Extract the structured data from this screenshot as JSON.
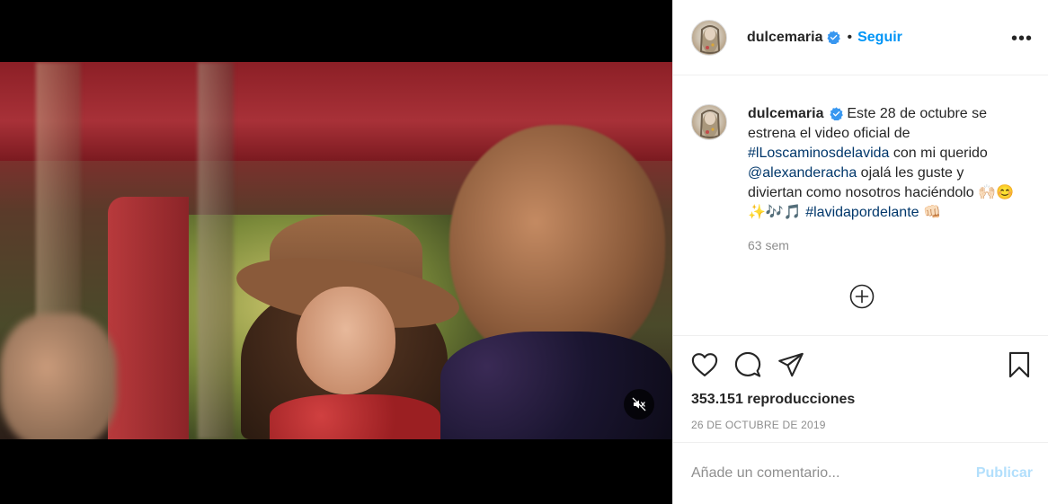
{
  "post": {
    "username": "dulcemaria",
    "follow_label": "Seguir",
    "dot": "•",
    "more_label": "•••",
    "caption": {
      "username": "dulcemaria",
      "text_1": " Este 28 de octubre se estrena el video oficial de ",
      "hashtag_1": "#lLoscaminosdelavida",
      "text_2": " con mi querido ",
      "mention": "@alexanderacha",
      "text_3": " ojalá les guste y diviertan como nosotros haciéndolo ",
      "emojis": "🙌🏻😊✨🎶🎵",
      "hashtag_2": "#lavidapordelante",
      "emoji_end": "👊🏻"
    },
    "time_ago": "63 sem",
    "views": "353.151 reproducciones",
    "date": "26 DE OCTUBRE DE 2019",
    "comment_placeholder": "Añade un comentario...",
    "publish_label": "Publicar"
  },
  "colors": {
    "accent": "#0095f6",
    "link": "#00376b",
    "muted": "#8e8e8e",
    "publish_disabled": "#b2dffc"
  },
  "icons": [
    "verified-badge-icon",
    "more-options-icon",
    "add-comment-circle-icon",
    "heart-icon",
    "comment-icon",
    "share-icon",
    "bookmark-icon",
    "muted-audio-icon"
  ]
}
